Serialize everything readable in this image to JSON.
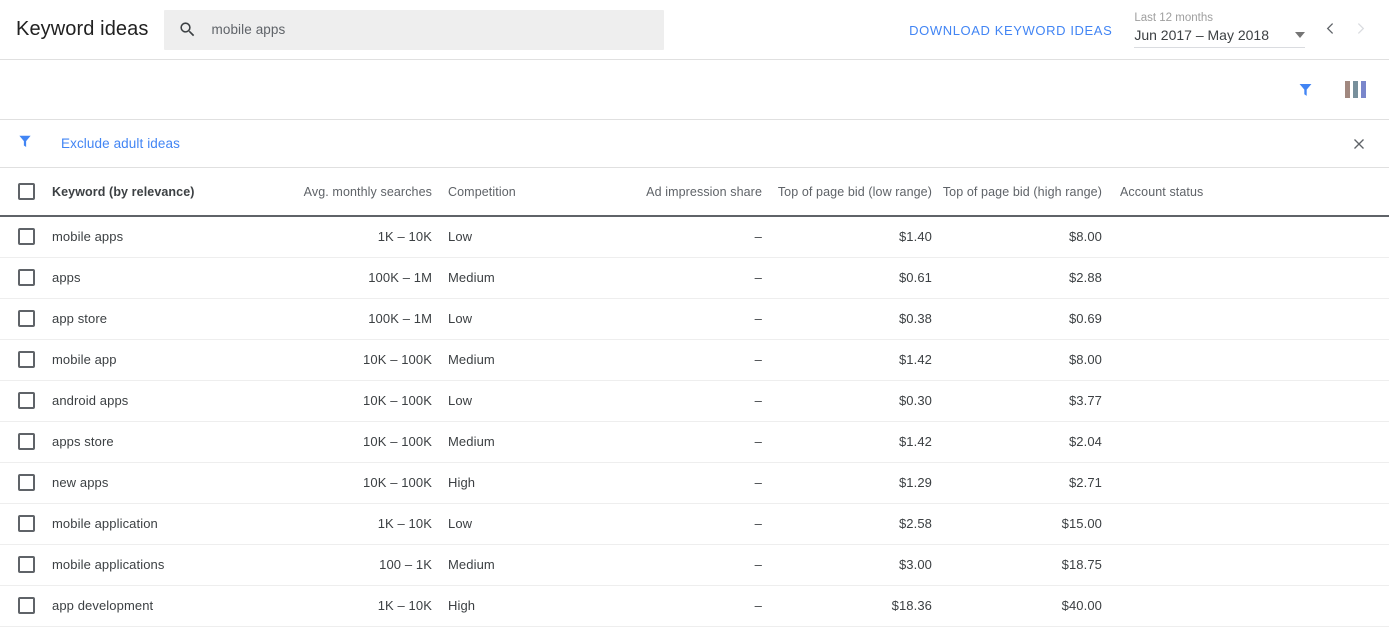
{
  "header": {
    "title": "Keyword ideas",
    "search": {
      "icon": "search-icon",
      "value": "mobile apps",
      "placeholder": "Search"
    },
    "download_label": "DOWNLOAD KEYWORD IDEAS",
    "date_range": {
      "label": "Last 12 months",
      "value": "Jun 2017 – May 2018",
      "dropdown_icon": "chevron-down-icon",
      "prev_icon": "chevron-left-icon",
      "next_icon": "chevron-right-icon"
    }
  },
  "toolbar": {
    "filter_icon": "filter-icon",
    "columns_icon": "columns-icon"
  },
  "filter_bar": {
    "icon": "filter-icon",
    "chip_label": "Exclude adult ideas",
    "close_icon": "close-icon"
  },
  "table": {
    "columns": [
      {
        "key": "select",
        "label": ""
      },
      {
        "key": "keyword",
        "label": "Keyword (by relevance)"
      },
      {
        "key": "volume",
        "label": "Avg. monthly searches"
      },
      {
        "key": "competition",
        "label": "Competition"
      },
      {
        "key": "impression",
        "label": "Ad impression share"
      },
      {
        "key": "bid_low",
        "label": "Top of page bid (low range)"
      },
      {
        "key": "bid_high",
        "label": "Top of page bid (high range)"
      },
      {
        "key": "account",
        "label": "Account status"
      }
    ],
    "rows": [
      {
        "keyword": "mobile apps",
        "volume": "1K – 10K",
        "competition": "Low",
        "impression": "–",
        "bid_low": "$1.40",
        "bid_high": "$8.00",
        "account": ""
      },
      {
        "keyword": "apps",
        "volume": "100K – 1M",
        "competition": "Medium",
        "impression": "–",
        "bid_low": "$0.61",
        "bid_high": "$2.88",
        "account": ""
      },
      {
        "keyword": "app store",
        "volume": "100K – 1M",
        "competition": "Low",
        "impression": "–",
        "bid_low": "$0.38",
        "bid_high": "$0.69",
        "account": ""
      },
      {
        "keyword": "mobile app",
        "volume": "10K – 100K",
        "competition": "Medium",
        "impression": "–",
        "bid_low": "$1.42",
        "bid_high": "$8.00",
        "account": ""
      },
      {
        "keyword": "android apps",
        "volume": "10K – 100K",
        "competition": "Low",
        "impression": "–",
        "bid_low": "$0.30",
        "bid_high": "$3.77",
        "account": ""
      },
      {
        "keyword": "apps store",
        "volume": "10K – 100K",
        "competition": "Medium",
        "impression": "–",
        "bid_low": "$1.42",
        "bid_high": "$2.04",
        "account": ""
      },
      {
        "keyword": "new apps",
        "volume": "10K – 100K",
        "competition": "High",
        "impression": "–",
        "bid_low": "$1.29",
        "bid_high": "$2.71",
        "account": ""
      },
      {
        "keyword": "mobile application",
        "volume": "1K – 10K",
        "competition": "Low",
        "impression": "–",
        "bid_low": "$2.58",
        "bid_high": "$15.00",
        "account": ""
      },
      {
        "keyword": "mobile applications",
        "volume": "100 – 1K",
        "competition": "Medium",
        "impression": "–",
        "bid_low": "$3.00",
        "bid_high": "$18.75",
        "account": ""
      },
      {
        "keyword": "app development",
        "volume": "1K – 10K",
        "competition": "High",
        "impression": "–",
        "bid_low": "$18.36",
        "bid_high": "$40.00",
        "account": ""
      }
    ]
  },
  "colors": {
    "accent_blue": "#4285f4",
    "text_primary": "#3c4043",
    "text_secondary": "#5f6368",
    "search_bg": "#eeeeee",
    "divider": "#e0e0e0"
  }
}
